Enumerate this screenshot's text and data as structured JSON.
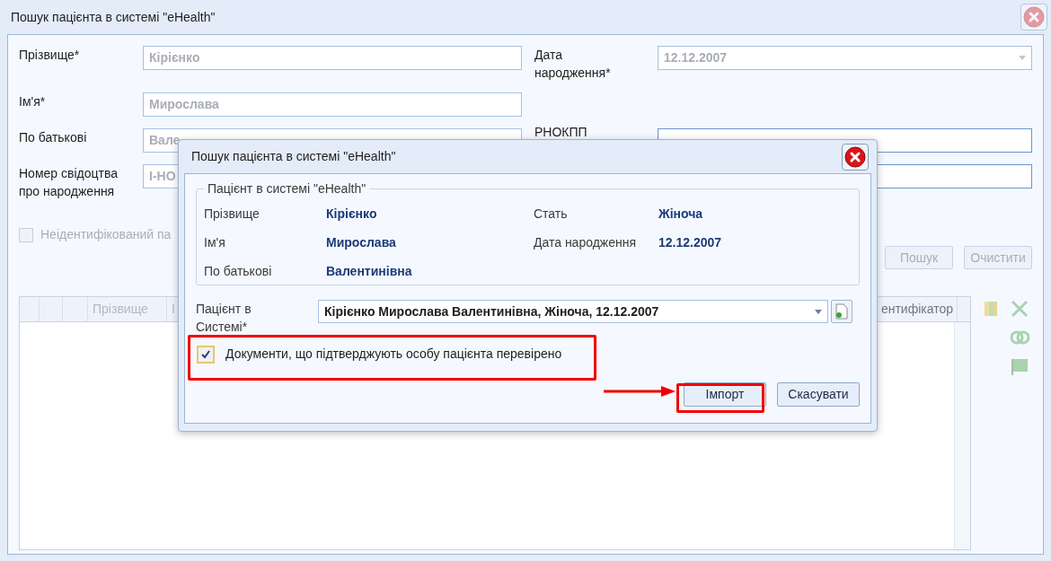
{
  "main_window": {
    "title": "Пошук пацієнта в системі \"eHealth\"",
    "left_fields": [
      {
        "label": "Прізвище*",
        "value": "Кірієнко"
      },
      {
        "label": "Ім'я*",
        "value": "Мирослава"
      },
      {
        "label": "По батькові",
        "value": "Вале"
      },
      {
        "label": "Номер свідоцтва про народження",
        "value": "І-НО"
      }
    ],
    "right_fields": [
      {
        "label": "Дата народження*",
        "value": "12.12.2007",
        "kind": "date"
      },
      {
        "label": "РНОКПП",
        "kind": "text"
      },
      {
        "kind": "text"
      }
    ],
    "unidentified": {
      "label": "Неідентифікований па",
      "checked": false
    },
    "buttons": [
      "Пошук",
      "Очистити"
    ],
    "table": {
      "columns": [
        "Прізвище",
        "І",
        "ентифікатор"
      ]
    }
  },
  "dialog": {
    "title": "Пошук пацієнта в системі \"eHealth\"",
    "group_title": "Пацієнт в системі \"eHealth\"",
    "info": [
      {
        "label": "Прізвище",
        "value": "Кірієнко"
      },
      {
        "label": "Стать",
        "value": "Жіноча"
      },
      {
        "label": "Ім'я",
        "value": "Мирослава"
      },
      {
        "label": "Дата народження",
        "value": "12.12.2007"
      },
      {
        "label": "По батькові",
        "value": "Валентинівна"
      }
    ],
    "patient_label": "Пацієнт в Системі*",
    "patient_value": "Кірієнко Мирослава Валентинівна, Жіноча, 12.12.2007",
    "verified": {
      "label": "Документи, що підтверджують особу пацієнта перевірено",
      "checked": true
    },
    "buttons": [
      "Імпорт",
      "Скасувати"
    ]
  }
}
